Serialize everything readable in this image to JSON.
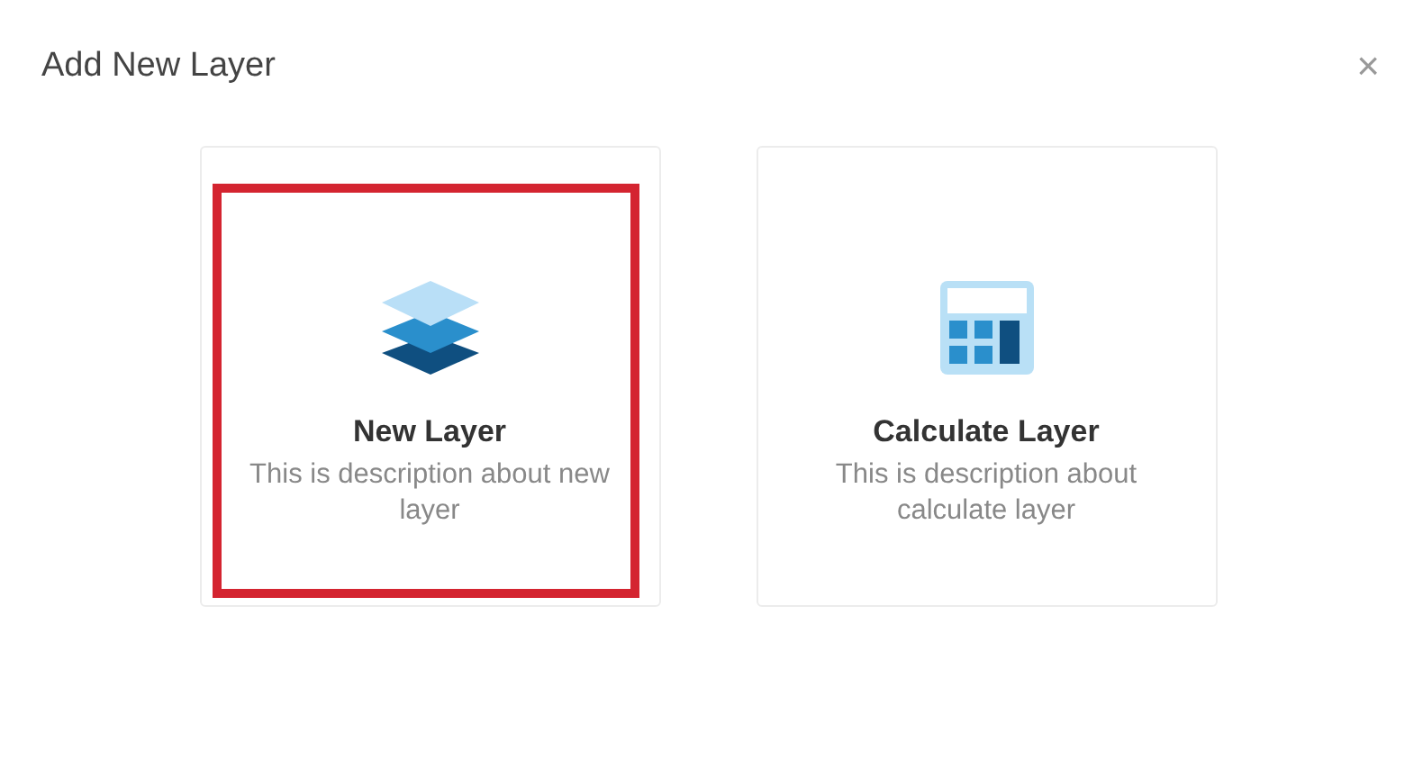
{
  "dialog": {
    "title": "Add New Layer",
    "close": "×"
  },
  "options": [
    {
      "kind": "layers",
      "title": "New Layer",
      "description": "This is description about new layer",
      "selected": true
    },
    {
      "kind": "calculator",
      "title": "Calculate Layer",
      "description": "This is description about calculate layer",
      "selected": false
    }
  ]
}
